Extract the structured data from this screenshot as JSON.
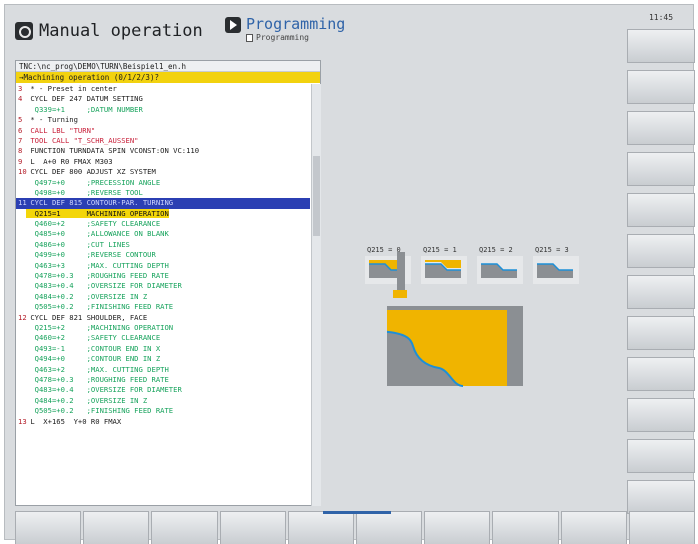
{
  "header": {
    "mode_title": "Manual operation",
    "active_title": "Programming",
    "active_sub": "Programming",
    "clock": "11:45"
  },
  "program": {
    "path": "TNC:\\nc_prog\\DEMO\\TURN\\Beispiel1_en.h",
    "prompt": "→Machining operation (0/1/2/3)?"
  },
  "graphic": {
    "q0": "Q215 = 0",
    "q1": "Q215 = 1",
    "q2": "Q215 = 2",
    "q3": "Q215 = 3"
  },
  "lines": [
    {
      "n": "3",
      "t": " * - Preset in center"
    },
    {
      "n": "4",
      "t": " CYCL DEF 247 DATUM SETTING"
    },
    {
      "n": "",
      "t": "  Q339=+1     ;DATUM NUMBER"
    },
    {
      "n": "5",
      "t": " * - Turning"
    },
    {
      "n": "6",
      "t": " CALL LBL \"TURN\""
    },
    {
      "n": "7",
      "t": " TOOL CALL \"T_SCHR_AUSSEN\""
    },
    {
      "n": "8",
      "t": " FUNCTION TURNDATA SPIN VCONST:ON VC:110"
    },
    {
      "n": "9",
      "t": " L  A+0 R0 FMAX M303"
    },
    {
      "n": "10",
      "t": " CYCL DEF 800 ADJUST XZ SYSTEM"
    },
    {
      "n": "",
      "t": "  Q497=+0     ;PRECESSION ANGLE"
    },
    {
      "n": "",
      "t": "  Q498=+0     ;REVERSE TOOL"
    },
    {
      "n": "11",
      "t": " CYCL DEF 815 CONTOUR-PAR. TURNING"
    },
    {
      "n": "",
      "t": "  Q215=1      MACHINING OPERATION"
    },
    {
      "n": "",
      "t": "  Q460=+2     ;SAFETY CLEARANCE"
    },
    {
      "n": "",
      "t": "  Q485=+0     ;ALLOWANCE ON BLANK"
    },
    {
      "n": "",
      "t": "  Q486=+0     ;CUT LINES"
    },
    {
      "n": "",
      "t": "  Q499=+0     ;REVERSE CONTOUR"
    },
    {
      "n": "",
      "t": "  Q463=+3     ;MAX. CUTTING DEPTH"
    },
    {
      "n": "",
      "t": "  Q478=+0.3   ;ROUGHING FEED RATE"
    },
    {
      "n": "",
      "t": "  Q483=+0.4   ;OVERSIZE FOR DIAMETER"
    },
    {
      "n": "",
      "t": "  Q484=+0.2   ;OVERSIZE IN Z"
    },
    {
      "n": "",
      "t": "  Q505=+0.2   ;FINISHING FEED RATE"
    },
    {
      "n": "12",
      "t": " CYCL DEF 821 SHOULDER, FACE"
    },
    {
      "n": "",
      "t": "  Q215=+2     ;MACHINING OPERATION"
    },
    {
      "n": "",
      "t": "  Q460=+2     ;SAFETY CLEARANCE"
    },
    {
      "n": "",
      "t": "  Q493=-1     ;CONTOUR END IN X"
    },
    {
      "n": "",
      "t": "  Q494=+0     ;CONTOUR END IN Z"
    },
    {
      "n": "",
      "t": "  Q463=+2     ;MAX. CUTTING DEPTH"
    },
    {
      "n": "",
      "t": "  Q478=+0.3   ;ROUGHING FEED RATE"
    },
    {
      "n": "",
      "t": "  Q483=+0.4   ;OVERSIZE FOR DIAMETER"
    },
    {
      "n": "",
      "t": "  Q484=+0.2   ;OVERSIZE IN Z"
    },
    {
      "n": "",
      "t": "  Q505=+0.2   ;FINISHING FEED RATE"
    },
    {
      "n": "13",
      "t": " L  X+165  Y+0 R0 FMAX"
    }
  ],
  "colors": {
    "prompt_bar": "#f2d20f",
    "selection": "#2b3fb3",
    "material": "#f0b400",
    "contour": "#1d8fd8"
  }
}
